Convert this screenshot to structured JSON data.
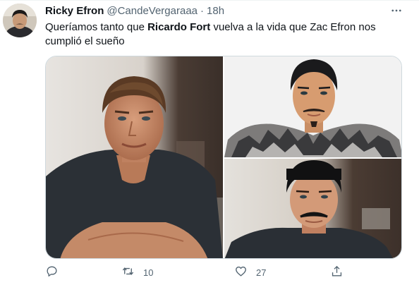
{
  "tweet": {
    "author_name": "Ricky Efron",
    "handle": "@CandeVergaraaa",
    "separator": "·",
    "time": "18h",
    "text_before": "Queríamos tanto que ",
    "text_bold": "Ricardo Fort",
    "text_line1_after": " vuelva a la vida que Zac Efron nos",
    "text_line2": "cumplió el sueño",
    "retweet_count": "10",
    "like_count": "27"
  },
  "icons": {
    "more": "more-icon",
    "reply": "reply-icon",
    "retweet": "retweet-icon",
    "like": "like-icon",
    "share": "share-icon"
  },
  "colors": {
    "text": "#0f1419",
    "secondary": "#536471",
    "border": "#cfd9de"
  }
}
